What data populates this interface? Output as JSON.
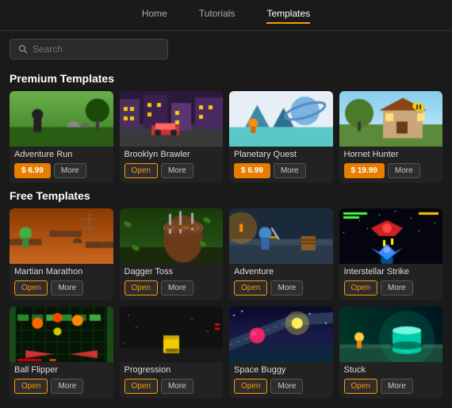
{
  "nav": {
    "items": [
      {
        "label": "Home",
        "active": false
      },
      {
        "label": "Tutorials",
        "active": false
      },
      {
        "label": "Templates",
        "active": true
      }
    ]
  },
  "search": {
    "placeholder": "Search"
  },
  "premium": {
    "section_title": "Premium Templates",
    "templates": [
      {
        "id": "adventure-run",
        "title": "Adventure Run",
        "price": "$ 6.99",
        "has_open": false,
        "bg": "#3a7a2a",
        "thumb_type": "adventure_run"
      },
      {
        "id": "brooklyn-brawler",
        "title": "Brooklyn Brawler",
        "price": null,
        "has_open": true,
        "bg": "#4a3060",
        "thumb_type": "brooklyn_brawler"
      },
      {
        "id": "planetary-quest",
        "title": "Planetary Quest",
        "price": "$ 6.99",
        "has_open": false,
        "bg": "#1a3a6a",
        "thumb_type": "planetary_quest"
      },
      {
        "id": "hornet-hunter",
        "title": "Hornet Hunter",
        "price": "$ 19.99",
        "has_open": false,
        "bg": "#5a3a1a",
        "thumb_type": "hornet_hunter"
      }
    ]
  },
  "free": {
    "section_title": "Free Templates",
    "templates": [
      {
        "id": "martian-marathon",
        "title": "Martian Marathon",
        "bg": "#6a3a1a",
        "thumb_type": "martian"
      },
      {
        "id": "dagger-toss",
        "title": "Dagger Toss",
        "bg": "#2a5a2a",
        "thumb_type": "dagger"
      },
      {
        "id": "adventure",
        "title": "Adventure",
        "bg": "#2a4a6a",
        "thumb_type": "adventure_free"
      },
      {
        "id": "interstellar-strike",
        "title": "Interstellar Strike",
        "bg": "#1a1a3a",
        "thumb_type": "interstellar"
      },
      {
        "id": "ball-flipper",
        "title": "Ball Flipper",
        "bg": "#0a2a0a",
        "thumb_type": "ball_flipper"
      },
      {
        "id": "progression",
        "title": "Progression",
        "bg": "#1a1a1a",
        "thumb_type": "progression"
      },
      {
        "id": "space-buggy",
        "title": "Space Buggy",
        "bg": "#0a1a3a",
        "thumb_type": "space_buggy"
      },
      {
        "id": "stuck",
        "title": "Stuck",
        "bg": "#001a2a",
        "thumb_type": "stuck"
      }
    ]
  },
  "labels": {
    "open": "Open",
    "more": "More"
  }
}
